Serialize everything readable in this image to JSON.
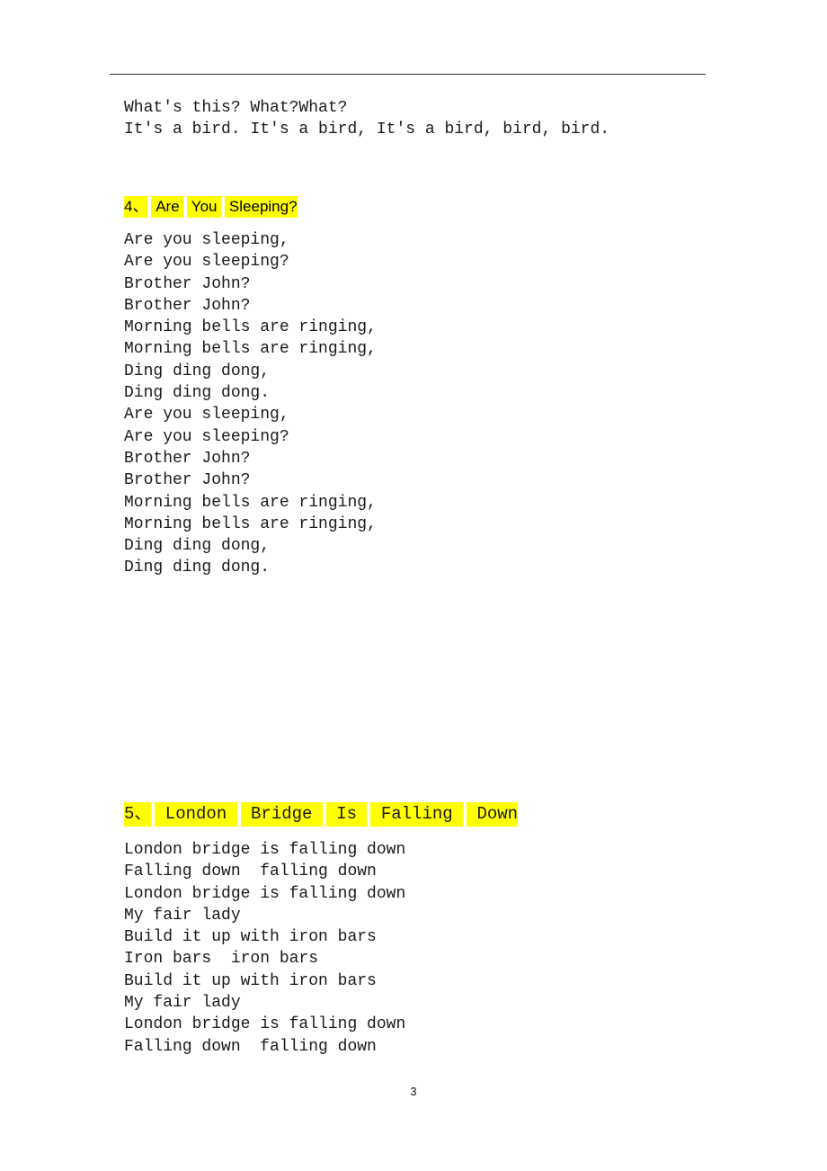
{
  "document": {
    "page_number": "3",
    "highlight_color": "#ffff00",
    "text_color": "#1a1a1a",
    "rule_color": "#2b2b2b"
  },
  "blocks": {
    "bird_song": {
      "lines": [
        "What's this? What?What?",
        "It's a bird. It's a bird, It's a bird, bird, bird."
      ]
    },
    "sleeping_song": {
      "number": "4、",
      "title": "Are You Sleeping?",
      "title_words": [
        "4、",
        "Are",
        "You",
        "Sleeping?"
      ],
      "lines": [
        "Are you sleeping,",
        "Are you sleeping?",
        "Brother John?",
        "Brother John?",
        "Morning bells are ringing,",
        "Morning bells are ringing,",
        "Ding ding dong,",
        "Ding ding dong.",
        "Are you sleeping,",
        "Are you sleeping?",
        "Brother John?",
        "Brother John?",
        "Morning bells are ringing,",
        "Morning bells are ringing,",
        "Ding ding dong,",
        "Ding ding dong."
      ]
    },
    "london_bridge_song": {
      "number": "5、",
      "title": "London Bridge Is Falling Down",
      "title_words": [
        "5、",
        "London",
        "Bridge",
        "Is",
        "Falling",
        "Down"
      ],
      "lines": [
        "London bridge is falling down",
        "Falling down  falling down",
        "London bridge is falling down",
        "My fair lady",
        "Build it up with iron bars",
        "Iron bars  iron bars",
        "Build it up with iron bars",
        "My fair lady",
        "London bridge is falling down",
        "Falling down  falling down"
      ]
    }
  }
}
